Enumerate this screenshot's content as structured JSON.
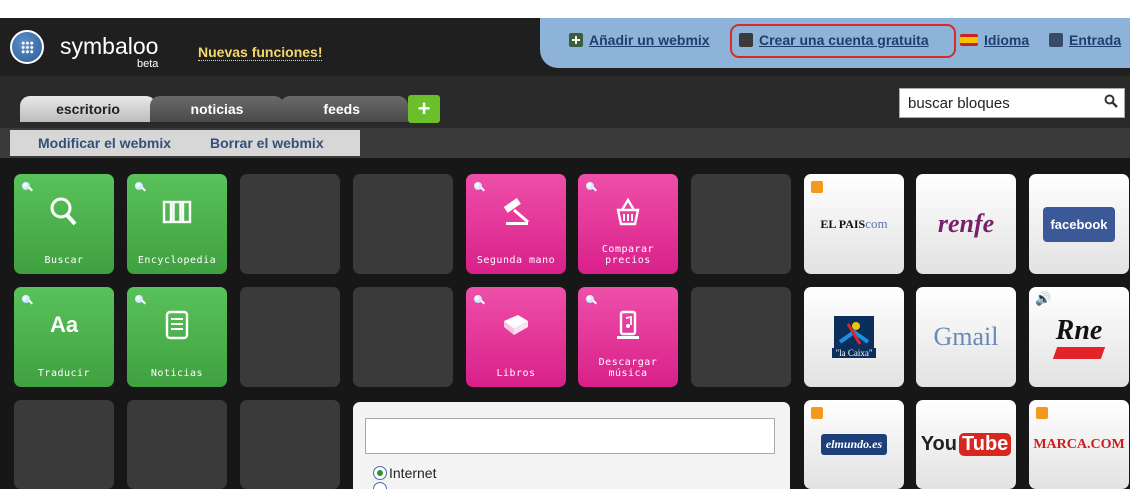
{
  "header": {
    "logo": "symbaloo",
    "logo_sub": "beta",
    "news": "Nuevas funciones!",
    "links": {
      "add_webmix": "Añadir un webmix",
      "create_account": "Crear una cuenta gratuita",
      "language": "Idioma",
      "login": "Entrada"
    }
  },
  "tabs": [
    "escritorio",
    "noticias",
    "feeds"
  ],
  "search": {
    "value": "buscar bloques"
  },
  "subbar": {
    "modify": "Modificar el webmix",
    "delete": "Borrar el webmix"
  },
  "tiles": {
    "buscar": "Buscar",
    "encyclopedia": "Encyclopedia",
    "segunda_mano": "Segunda mano",
    "comparar": "Comparar precios",
    "traducir": "Traducir",
    "noticias": "Noticias",
    "libros": "Libros",
    "descargar": "Descargar música",
    "elpais": "EL PAIS",
    "elpais_com": "com",
    "renfe": "renfe",
    "facebook": "facebook",
    "lacaixa": "\"la Caixa\"",
    "gmail": "Gmail",
    "rne": "Rne",
    "elmundo": "elmundo.es",
    "youtube_you": "You",
    "youtube_tube": "Tube",
    "marca": "MARCA.COM"
  },
  "search_panel": {
    "option_internet": "Internet"
  },
  "colors": {
    "green": "#4cb24c",
    "pink": "#e93a9c",
    "highlight": "#d42a2a"
  }
}
